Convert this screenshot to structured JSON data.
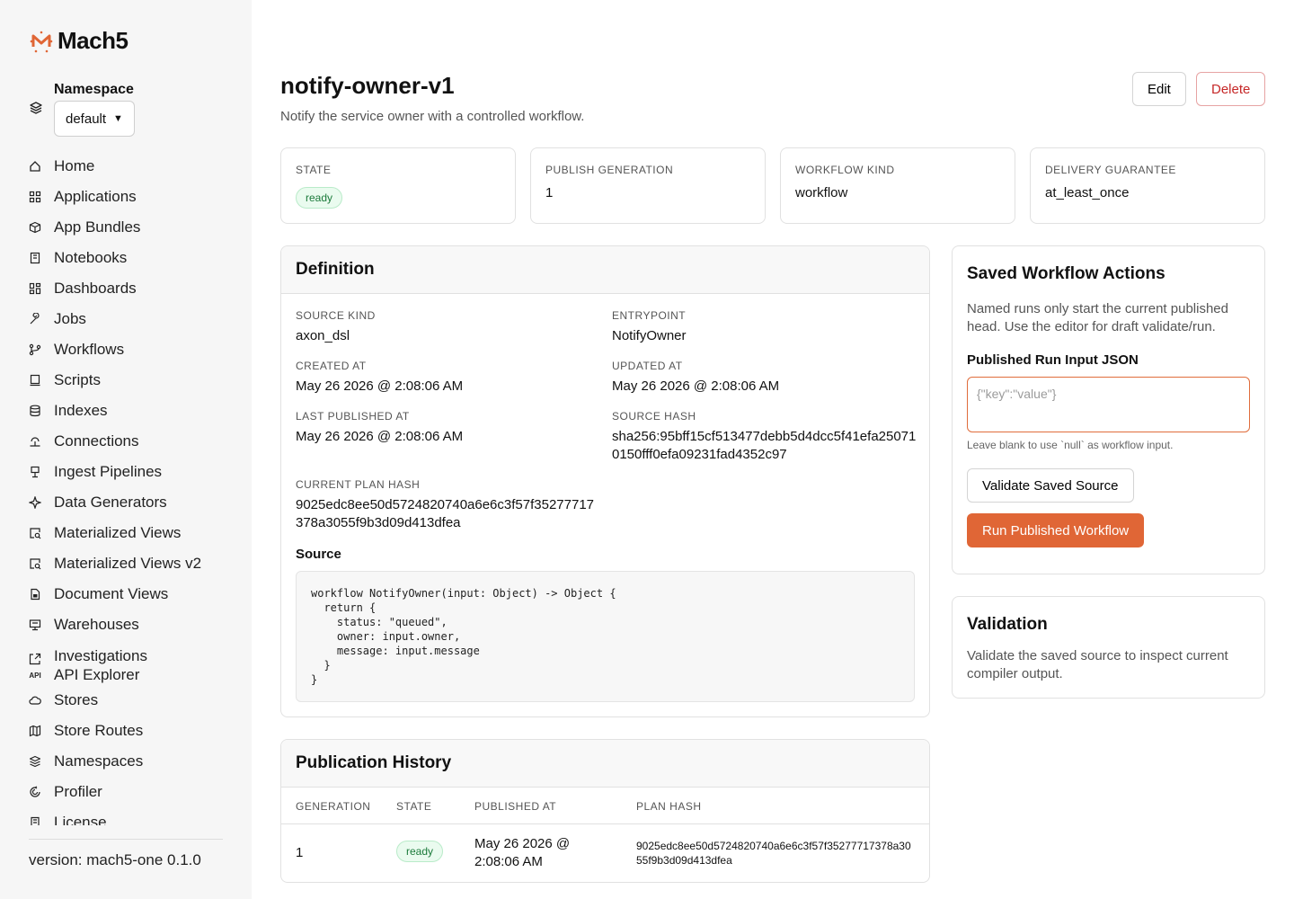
{
  "app": {
    "name": "Mach5",
    "version_text": "version: mach5-one 0.1.0"
  },
  "namespace": {
    "label": "Namespace",
    "selected": "default"
  },
  "nav": [
    {
      "label": "Home",
      "icon": "home-icon"
    },
    {
      "label": "Applications",
      "icon": "grid-icon"
    },
    {
      "label": "App Bundles",
      "icon": "box-icon"
    },
    {
      "label": "Notebooks",
      "icon": "notebook-icon"
    },
    {
      "label": "Dashboards",
      "icon": "dashboard-icon"
    },
    {
      "label": "Jobs",
      "icon": "wrench-icon"
    },
    {
      "label": "Workflows",
      "icon": "workflow-icon"
    },
    {
      "label": "Scripts",
      "icon": "script-icon"
    },
    {
      "label": "Indexes",
      "icon": "database-icon"
    },
    {
      "label": "Connections",
      "icon": "connection-icon"
    },
    {
      "label": "Ingest Pipelines",
      "icon": "pipeline-icon"
    },
    {
      "label": "Data Generators",
      "icon": "sparkle-icon"
    },
    {
      "label": "Materialized Views",
      "icon": "view-icon"
    },
    {
      "label": "Materialized Views v2",
      "icon": "view-icon"
    },
    {
      "label": "Document Views",
      "icon": "document-icon"
    },
    {
      "label": "Warehouses",
      "icon": "warehouse-icon"
    },
    {
      "label": "Investigations",
      "icon": "investigation-icon"
    },
    {
      "label": "API Explorer",
      "icon": "api-icon"
    },
    {
      "label": "Stores",
      "icon": "cloud-icon"
    },
    {
      "label": "Store Routes",
      "icon": "map-icon"
    },
    {
      "label": "Namespaces",
      "icon": "layers-icon"
    },
    {
      "label": "Profiler",
      "icon": "profiler-icon"
    },
    {
      "label": "License",
      "icon": "license-icon"
    }
  ],
  "page": {
    "title": "notify-owner-v1",
    "subtitle": "Notify the service owner with a controlled workflow.",
    "edit_label": "Edit",
    "delete_label": "Delete"
  },
  "stats": [
    {
      "label": "STATE",
      "value": "ready",
      "badge": true
    },
    {
      "label": "PUBLISH GENERATION",
      "value": "1"
    },
    {
      "label": "WORKFLOW KIND",
      "value": "workflow"
    },
    {
      "label": "DELIVERY GUARANTEE",
      "value": "at_least_once"
    }
  ],
  "definition": {
    "title": "Definition",
    "source_kind_label": "SOURCE KIND",
    "source_kind": "axon_dsl",
    "entrypoint_label": "ENTRYPOINT",
    "entrypoint": "NotifyOwner",
    "created_label": "CREATED AT",
    "created": "May 26 2026 @ 2:08:06 AM",
    "updated_label": "UPDATED AT",
    "updated": "May 26 2026 @ 2:08:06 AM",
    "published_label": "LAST PUBLISHED AT",
    "published": "May 26 2026 @ 2:08:06 AM",
    "source_hash_label": "SOURCE HASH",
    "source_hash": "sha256:95bff15cf513477debb5d4dcc5f41efa250710150fff0efa09231fad4352c97",
    "plan_hash_label": "CURRENT PLAN HASH",
    "plan_hash": "9025edc8ee50d5724820740a6e6c3f57f35277717378a3055f9b3d09d413dfea",
    "source_label": "Source",
    "source_code": "workflow NotifyOwner(input: Object) -> Object {\n  return {\n    status: \"queued\",\n    owner: input.owner,\n    message: input.message\n  }\n}"
  },
  "history": {
    "title": "Publication History",
    "columns": [
      "GENERATION",
      "STATE",
      "PUBLISHED AT",
      "PLAN HASH"
    ],
    "rows": [
      {
        "generation": "1",
        "state": "ready",
        "published": "May 26 2026 @ 2:08:06 AM",
        "plan_hash": "9025edc8ee50d5724820740a6e6c3f57f35277717378a3055f9b3d09d413dfea"
      }
    ]
  },
  "actions": {
    "title": "Saved Workflow Actions",
    "description": "Named runs only start the current published head. Use the editor for draft validate/run.",
    "input_label": "Published Run Input JSON",
    "input_placeholder": "{\"key\":\"value\"}",
    "input_value": "",
    "hint": "Leave blank to use `null` as workflow input.",
    "validate_label": "Validate Saved Source",
    "run_label": "Run Published Workflow"
  },
  "validation": {
    "title": "Validation",
    "description": "Validate the saved source to inspect current compiler output."
  },
  "colors": {
    "accent": "#e06636",
    "danger": "#c62828",
    "success": "#1b7a3a"
  }
}
